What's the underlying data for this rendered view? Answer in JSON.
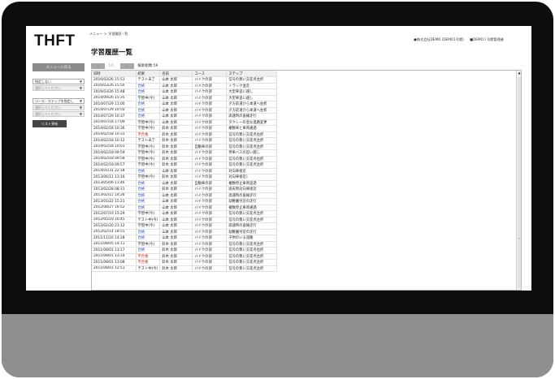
{
  "app": {
    "logo": "THFT",
    "breadcrumb": [
      "メニュー",
      "学習履歴一覧"
    ],
    "breadcrumb_sep": ">",
    "user": {
      "company": "●株式会社DEMO (DEMO1号館)",
      "account": "■DEMO１号館管理者"
    },
    "page_title": "学習履歴一覧"
  },
  "sidebar": {
    "menu_button": "メニューに戻る",
    "filter_type": "指定しない",
    "filter_type_sub": "選択してください",
    "filter_course": "コース・ステップを指定し",
    "filter_course_sub1": "選択してください",
    "filter_course_sub2": "選択してください",
    "list_button": "リスト更新"
  },
  "pager": {
    "prev": "<",
    "page": "1/1",
    "next": ">",
    "total": "検索総数:59"
  },
  "table": {
    "headers": [
      "日時",
      "結果",
      "名前",
      "コース",
      "ステップ"
    ],
    "rows": [
      [
        "2016/03/26 15:53",
        "テスト未了",
        "山本 太郎",
        "バイクの部",
        "信号の無い交差点左折"
      ],
      [
        "2016/03/26 15:50",
        "合格",
        "山本 太郎",
        "バイクの部",
        "トラック並走"
      ],
      [
        "2016/03/26 15:48",
        "合格",
        "山本 太郎",
        "バイクの部",
        "大型車追い越し"
      ],
      [
        "2014/09/26 15:35",
        "学習中(今)",
        "山本 太郎",
        "バイクの部",
        "大型車追い越し"
      ],
      [
        "2014/07/29 11:00",
        "合格",
        "山本 太郎",
        "バイクの部",
        "夕方前道から本道へ右折"
      ],
      [
        "2014/07/29 10:50",
        "合格",
        "山本 太郎",
        "バイクの部",
        "夕方前道から本道へ右折"
      ],
      [
        "2014/07/29 10:37",
        "合格",
        "山本 太郎",
        "バイクの部",
        "高速時の直線走行"
      ],
      [
        "2014/07/18 17:09",
        "学習中(今)",
        "山本 太郎",
        "バイクの部",
        "タクシーの急な進路変更"
      ],
      [
        "2014/02/18 10:36",
        "学習中(今)",
        "鈴木 太郎",
        "バイクの部",
        "複数車と車両通過"
      ],
      [
        "2014/02/18 10:31",
        "不合格",
        "鈴木 太郎",
        "バイクの部",
        "信号の無い交差点右折"
      ],
      [
        "2014/02/18 10:12",
        "テスト未了",
        "鈴木 太郎",
        "バイクの部",
        "信号の無い交差点左折"
      ],
      [
        "2014/02/18 10:01",
        "学習中(今)",
        "鈴木 太郎",
        "自動車の部",
        "信号の無い交差点左折"
      ],
      [
        "2014/02/18 09:59",
        "学習中(今)",
        "鈴木 太郎",
        "バイクの部",
        "停車バスの追い越し"
      ],
      [
        "2014/02/18 09:58",
        "学習中(今)",
        "鈴木 太郎",
        "バイクの部",
        "信号の無い交差点右折"
      ],
      [
        "2014/02/18 09:57",
        "学習中(今)",
        "鈴木 太郎",
        "バイクの部",
        "信号の無い交差点左折"
      ],
      [
        "2014/01/31 22:18",
        "合格",
        "山本 太郎",
        "バイクの部",
        "対向車接近"
      ],
      [
        "2013/06/11 13:16",
        "学習中(今)",
        "鈴木 太郎",
        "バイクの部",
        "対向車接近]"
      ],
      [
        "2013/05/06 11:46",
        "合格",
        "山本 太郎",
        "自動車の部",
        "複数停止車両追過"
      ],
      [
        "2013/02/28 08:31",
        "合格",
        "鈴木 太郎",
        "バイクの部",
        "雨天時対向車接近"
      ],
      [
        "2013/02/15 14:26",
        "合格",
        "山本 太郎",
        "バイクの部",
        "高速時の直線走行"
      ],
      [
        "2013/01/22 15:21",
        "合格",
        "山本 太郎",
        "バイクの部",
        "幼稚園付近の走行"
      ],
      [
        "2012/08/27 16:52",
        "合格",
        "山本 太郎",
        "バイクの部",
        "複数停止車両通過"
      ],
      [
        "2012/07/19 15:29",
        "学習中(今)",
        "山本 太郎",
        "バイクの部",
        "信号の無い交差点左折"
      ],
      [
        "2012/05/19 10:45",
        "テスト中(今)",
        "山本 太郎",
        "バイクの部",
        "信号の無い交差点左折"
      ],
      [
        "2012/02/20 21:12",
        "学習中(今)",
        "山本 太郎",
        "バイクの部",
        "高速時の直線走行"
      ],
      [
        "2012/02/14 18:55",
        "合格",
        "山本 太郎",
        "バイクの部",
        "幼稚園付近の走行"
      ],
      [
        "2011/11/16 14:28",
        "合格",
        "山本 太郎",
        "バイクの部",
        "子供のいる道路"
      ],
      [
        "2011/08/05 14:11",
        "学習中(今)",
        "鈴木 太郎",
        "バイクの部",
        "信号の無い交差点左折"
      ],
      [
        "2011/08/01 13:17",
        "合格",
        "鈴木 太郎",
        "バイクの部",
        "信号の無い交差点右折"
      ],
      [
        "2011/08/01 13:14",
        "不合格",
        "鈴木 太郎",
        "バイクの部",
        "信号の無い交差点左折"
      ],
      [
        "2011/08/01 13:08",
        "不合格",
        "鈴木 太郎",
        "バイクの部",
        "信号の無い交差点左折"
      ],
      [
        "2011/08/01 12:51",
        "テスト中(今)",
        "鈴木 太郎",
        "バイクの部",
        "信号の無い交差点左折"
      ]
    ]
  },
  "colors": {
    "pass": "#1f4fbf",
    "fail": "#d01818",
    "bezel": "#0d0d0d",
    "chin": "#8f8f8f"
  },
  "icons": {
    "dropdown": "chevron-down-icon",
    "scroll_up": "triangle-up-icon"
  }
}
